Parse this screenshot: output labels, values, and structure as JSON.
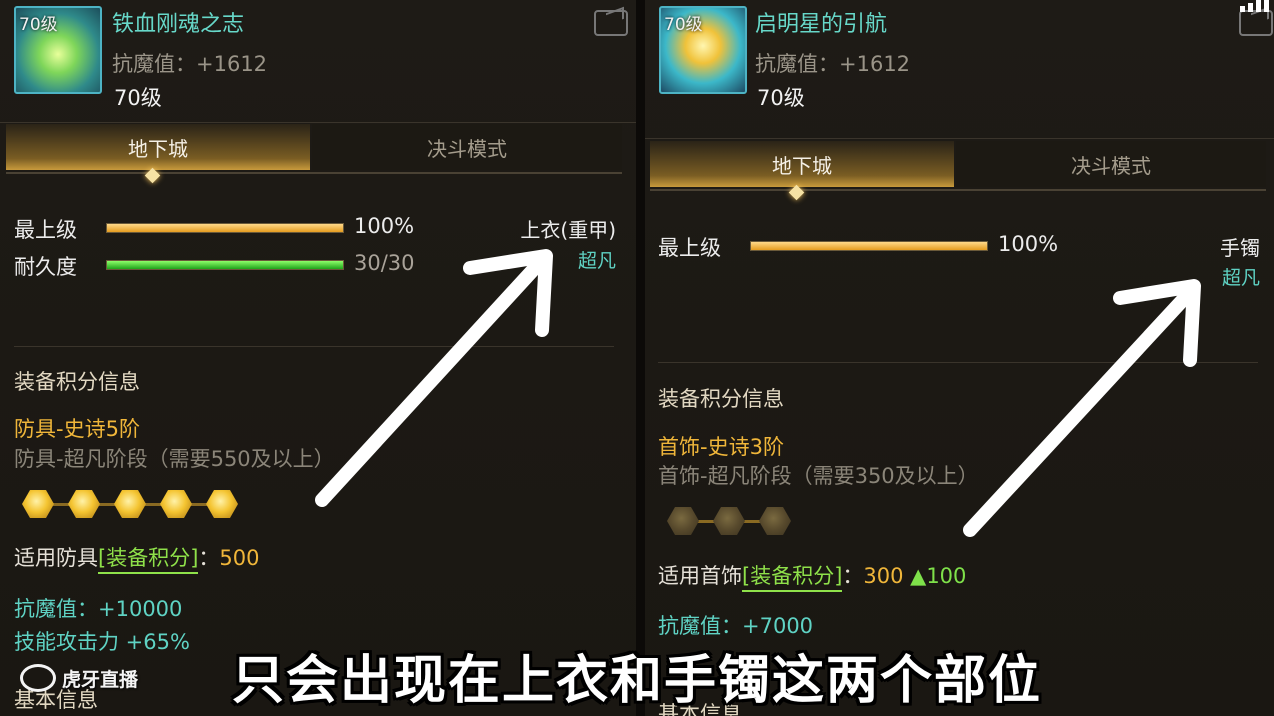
{
  "left": {
    "icon": {
      "level_tag": "70级",
      "name": "armor-item-icon"
    },
    "item_name": "铁血刚魂之志",
    "resist": "抗魔值：+1612",
    "item_level": "70级",
    "tabs": [
      "地下城",
      "决斗模式"
    ],
    "stats": [
      {
        "label": "最上级",
        "value": "100%",
        "fill": 1.0
      },
      {
        "label": "耐久度",
        "value": "30/30",
        "fill": 1.0
      }
    ],
    "slot": "上衣(重甲)",
    "rarity": "超凡",
    "section_title": "装备积分信息",
    "tier": "防具-史诗5阶",
    "tier_note": "防具-超凡阶段（需要550及以上）",
    "stars_filled": 5,
    "stars_total": 5,
    "apply_label": "适用防具",
    "apply_bracket": "[装备积分]",
    "apply_colon": "：",
    "apply_value": "500",
    "bonus1": "抗魔值：+10000",
    "bonus2": "技能攻击力 +65%",
    "basic_title": "基本信息"
  },
  "right": {
    "icon": {
      "level_tag": "70级",
      "name": "bracelet-item-icon"
    },
    "item_name": "启明星的引航",
    "resist": "抗魔值：+1612",
    "item_level": "70级",
    "tabs": [
      "地下城",
      "决斗模式"
    ],
    "stats": [
      {
        "label": "最上级",
        "value": "100%",
        "fill": 1.0
      }
    ],
    "slot": "手镯",
    "rarity": "超凡",
    "section_title": "装备积分信息",
    "tier": "首饰-史诗3阶",
    "tier_note": "首饰-超凡阶段（需要350及以上）",
    "stars_filled": 0,
    "stars_total": 3,
    "apply_label": "适用首饰",
    "apply_bracket": "[装备积分]",
    "apply_colon": "：",
    "apply_value": "300",
    "apply_delta": "▲100",
    "bonus1": "抗魔值：+7000",
    "basic_title": "基本信息"
  },
  "overlay": {
    "subtitle": "只会出现在上衣和手镯这两个部位",
    "watermark": "虎牙直播",
    "arrow_color": "#ffffff"
  },
  "colors": {
    "name_cyan": "#67d8c9",
    "tier_gold": "#f0b63a",
    "bracket_green": "#8fe14a",
    "bar_gold": "#e59c1f",
    "bar_green": "#1fa31a"
  }
}
